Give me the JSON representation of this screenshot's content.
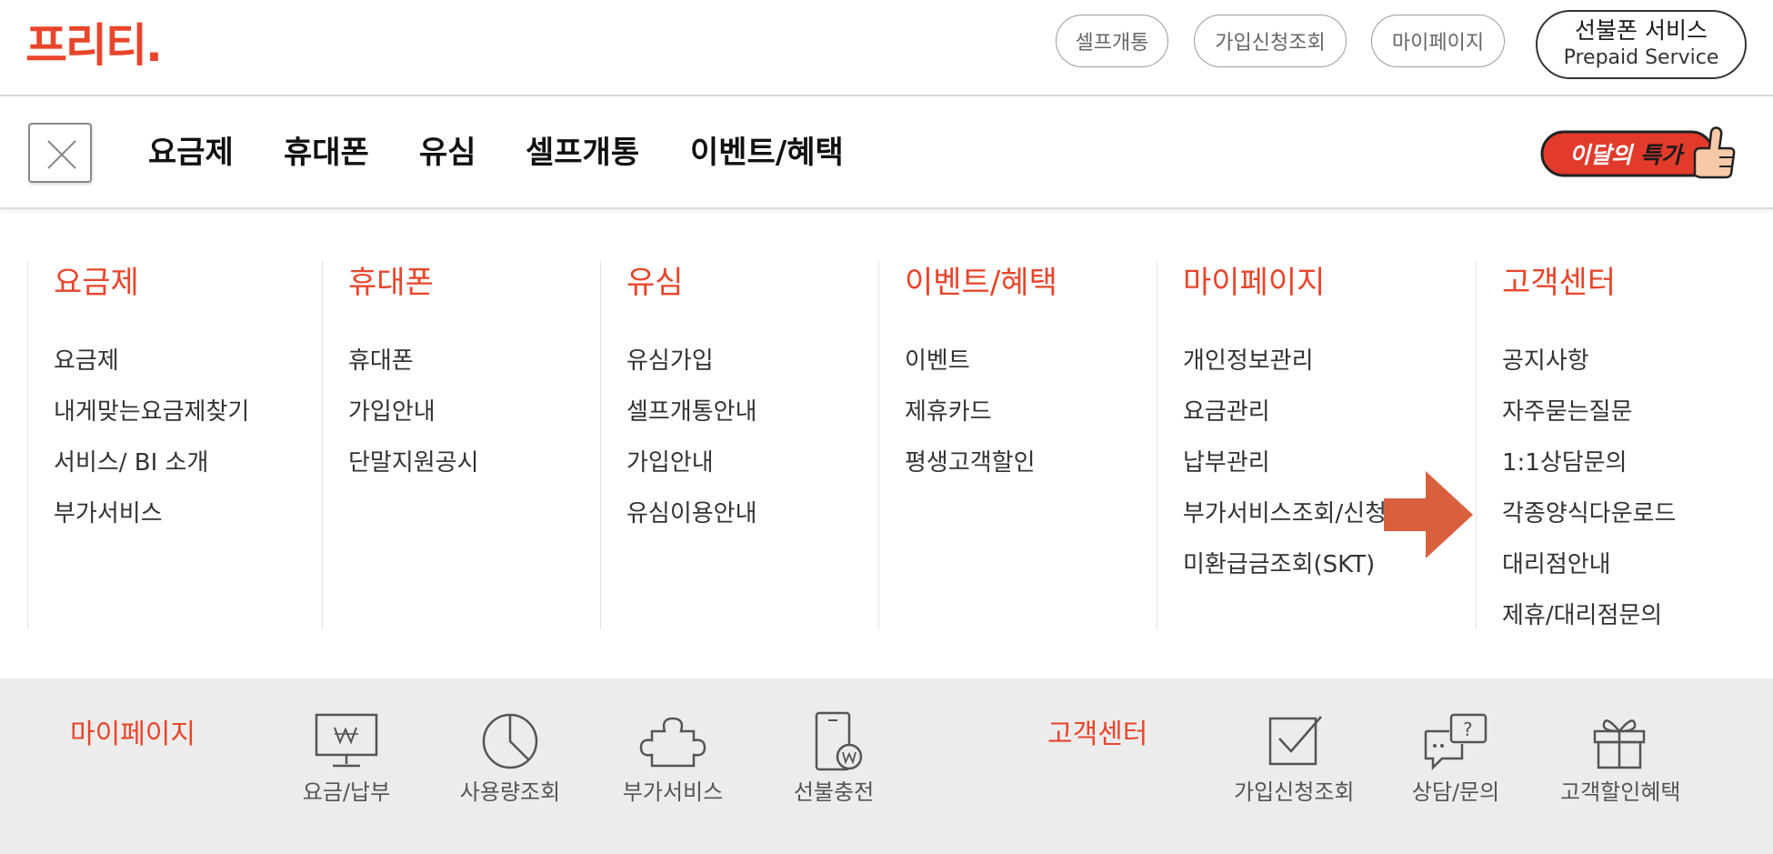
{
  "brand": {
    "logo_text": "프리티.",
    "accent": "#e8452b"
  },
  "top_links": [
    "셀프개통",
    "가입신청조회",
    "마이페이지"
  ],
  "prepaid": {
    "line1": "선불폰 서비스",
    "line2": "Prepaid Service"
  },
  "nav": {
    "close_icon": "close-icon",
    "items": [
      "요금제",
      "휴대폰",
      "유심",
      "셀프개통",
      "이벤트/혜택"
    ],
    "promo": {
      "text_a": "이달의",
      "text_b": "특가",
      "icon": "thumbs-up-icon"
    }
  },
  "menu": [
    {
      "title": "요금제",
      "items": [
        "요금제",
        "내게맞는요금제찾기",
        "서비스/ BI 소개",
        "부가서비스"
      ]
    },
    {
      "title": "휴대폰",
      "items": [
        "휴대폰",
        "가입안내",
        "단말지원공시"
      ]
    },
    {
      "title": "유심",
      "items": [
        "유심가입",
        "셀프개통안내",
        "가입안내",
        "유심이용안내"
      ]
    },
    {
      "title": "이벤트/혜택",
      "items": [
        "이벤트",
        "제휴카드",
        "평생고객할인"
      ]
    },
    {
      "title": "마이페이지",
      "items": [
        "개인정보관리",
        "요금관리",
        "납부관리",
        "부가서비스조회/신청",
        "미환급금조회(SKT)"
      ]
    },
    {
      "title": "고객센터",
      "items": [
        "공지사항",
        "자주묻는질문",
        "1:1상담문의",
        "각종양식다운로드",
        "대리점안내",
        "제휴/대리점문의"
      ]
    }
  ],
  "annotation": {
    "icon": "arrow-right-icon",
    "color": "#d9603f"
  },
  "quick": {
    "mypage": {
      "title": "마이페이지",
      "links": [
        {
          "label": "요금/납부",
          "icon": "monitor-won-icon"
        },
        {
          "label": "사용량조회",
          "icon": "pie-chart-icon"
        },
        {
          "label": "부가서비스",
          "icon": "puzzle-icon"
        },
        {
          "label": "선불충전",
          "icon": "phone-won-icon"
        }
      ]
    },
    "support": {
      "title": "고객센터",
      "links": [
        {
          "label": "가입신청조회",
          "icon": "checkbox-icon"
        },
        {
          "label": "상담/문의",
          "icon": "chat-question-icon"
        },
        {
          "label": "고객할인혜택",
          "icon": "gift-icon"
        }
      ]
    }
  }
}
